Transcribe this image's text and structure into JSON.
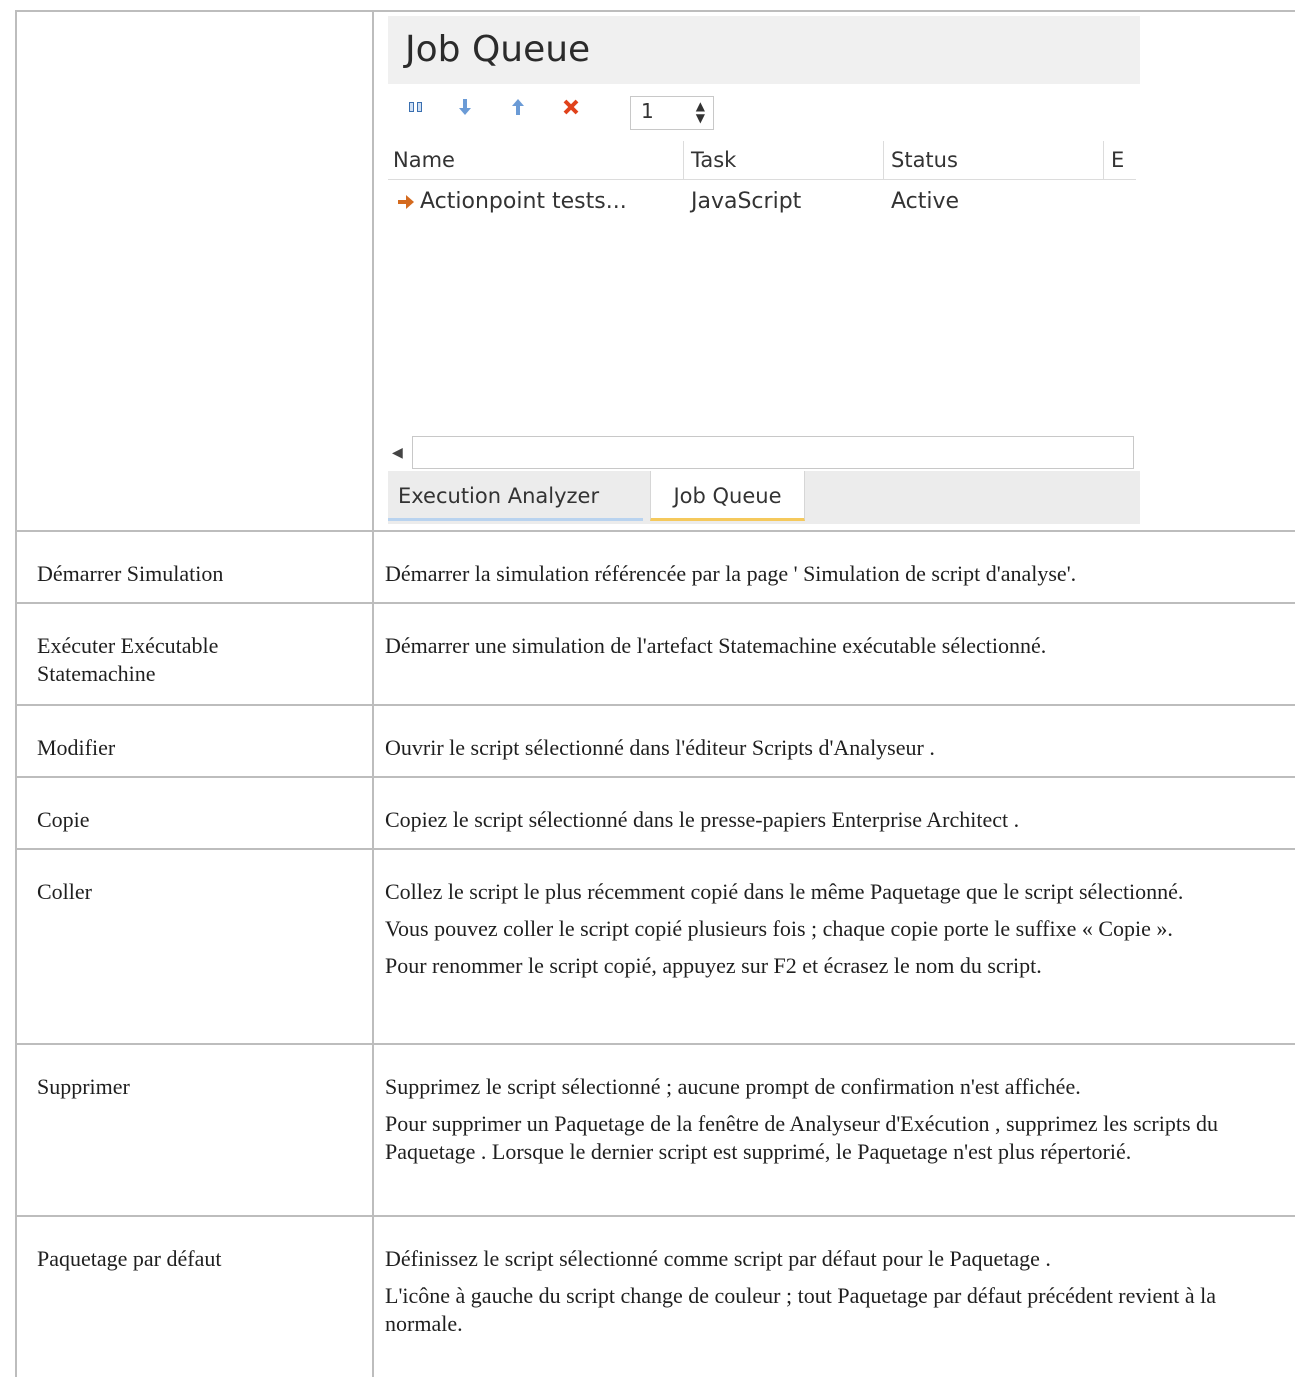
{
  "screenshot": {
    "title": "Job Queue",
    "toolbar": {
      "spin_value": "1",
      "icons": [
        "pause-icon",
        "move-down-icon",
        "move-up-icon",
        "delete-icon",
        "spinner-arrows-icon"
      ]
    },
    "columns": [
      "Name",
      "Task",
      "Status",
      "E"
    ],
    "rows": [
      {
        "name": "Actionpoint tests...",
        "task": "JavaScript",
        "status": "Active"
      }
    ],
    "tabs": [
      "Execution Analyzer",
      "Job Queue"
    ],
    "colors": {
      "delete": "#e0421b",
      "arrows": "#4a86c8",
      "row_arrow": "#d46a1e",
      "active_tab": "#f5c95c"
    }
  },
  "rows": [
    {
      "term": "Démarrer Simulation",
      "paras": [
        "Démarrer la simulation référencée par la page ' Simulation de script d'analyse'."
      ]
    },
    {
      "term": "Exécuter Exécutable Statemachine",
      "paras": [
        "Démarrer une simulation de l'artefact Statemachine exécutable sélectionné."
      ]
    },
    {
      "term": "Modifier",
      "paras": [
        "Ouvrir le script sélectionné dans l'éditeur Scripts d'Analyseur ."
      ]
    },
    {
      "term": "Copie",
      "paras": [
        "Copiez le script sélectionné dans le presse-papiers Enterprise Architect ."
      ]
    },
    {
      "term": "Coller",
      "paras": [
        "Collez le script le plus récemment copié dans le même Paquetage que le script sélectionné.",
        "Vous pouvez coller le script copié plusieurs fois ; chaque copie porte le suffixe « Copie ».",
        "Pour renommer le script copié, appuyez sur F2 et écrasez le nom du script."
      ]
    },
    {
      "term": "Supprimer",
      "paras": [
        "Supprimez le script sélectionné ; aucune prompt de confirmation n'est affichée.",
        "Pour supprimer un Paquetage de la fenêtre de Analyseur d'Exécution , supprimez les scripts du Paquetage . Lorsque le dernier script est supprimé, le Paquetage n'est plus répertorié."
      ]
    },
    {
      "term": "Paquetage par défaut",
      "paras": [
        "Définissez le script sélectionné comme script par défaut pour le Paquetage .",
        "L'icône à gauche du script change de couleur ; tout Paquetage par défaut précédent revient à la normale."
      ]
    }
  ]
}
